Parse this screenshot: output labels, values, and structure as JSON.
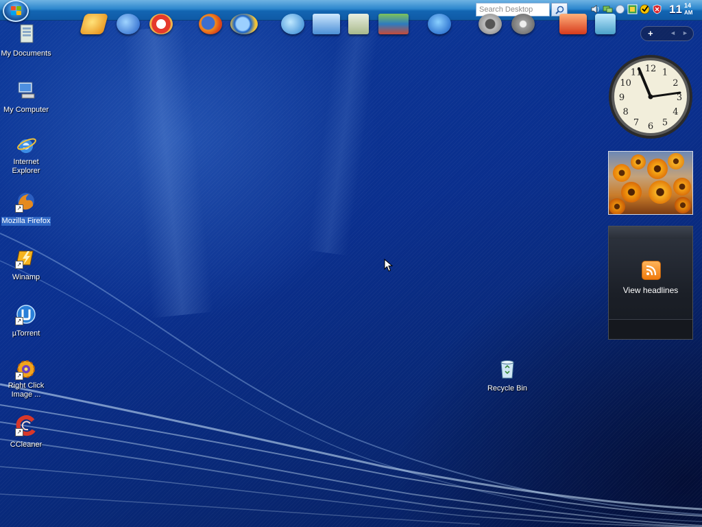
{
  "taskbar": {
    "search_placeholder": "Search Desktop",
    "clock": {
      "hour": "11",
      "minute": "14",
      "ampm": "AM"
    },
    "tray_icons": [
      "volume-icon",
      "network-icon",
      "bluetooth-icon",
      "security-center-icon",
      "norton-icon",
      "antivirus-shield-icon"
    ]
  },
  "dock": {
    "items": [
      "winamp-icon",
      "media-player-icon",
      "opera-icon",
      "firefox-icon",
      "internet-explorer-icon",
      "globe-icon",
      "monitor-icon",
      "notepad-icon",
      "books-icon",
      "utorrent-icon",
      "speaker-icon",
      "disc-icon",
      "mail-icon",
      "recycle-icon"
    ]
  },
  "desktop": {
    "icons": [
      {
        "label": "My Documents"
      },
      {
        "label": "My Computer"
      },
      {
        "label": "Internet Explorer"
      },
      {
        "label": "Mozilla Firefox"
      },
      {
        "label": "Winamp"
      },
      {
        "label": "µTorrent"
      },
      {
        "label": "Right Click Image ..."
      },
      {
        "label": "CCleaner"
      }
    ],
    "recycle_bin": {
      "label": "Recycle Bin"
    }
  },
  "sidebar": {
    "toolbar": {
      "add_label": "+",
      "prev_label": "◄",
      "next_label": "►"
    },
    "clock_numbers": [
      "12",
      "1",
      "2",
      "3",
      "4",
      "5",
      "6",
      "7",
      "8",
      "9",
      "10",
      "11"
    ],
    "feed": {
      "label": "View headlines"
    }
  },
  "colors": {
    "desktop": "#0a2f8e",
    "taskbar": "#2c86cd",
    "selection": "#3169c6",
    "rss": "#f07b0c"
  }
}
